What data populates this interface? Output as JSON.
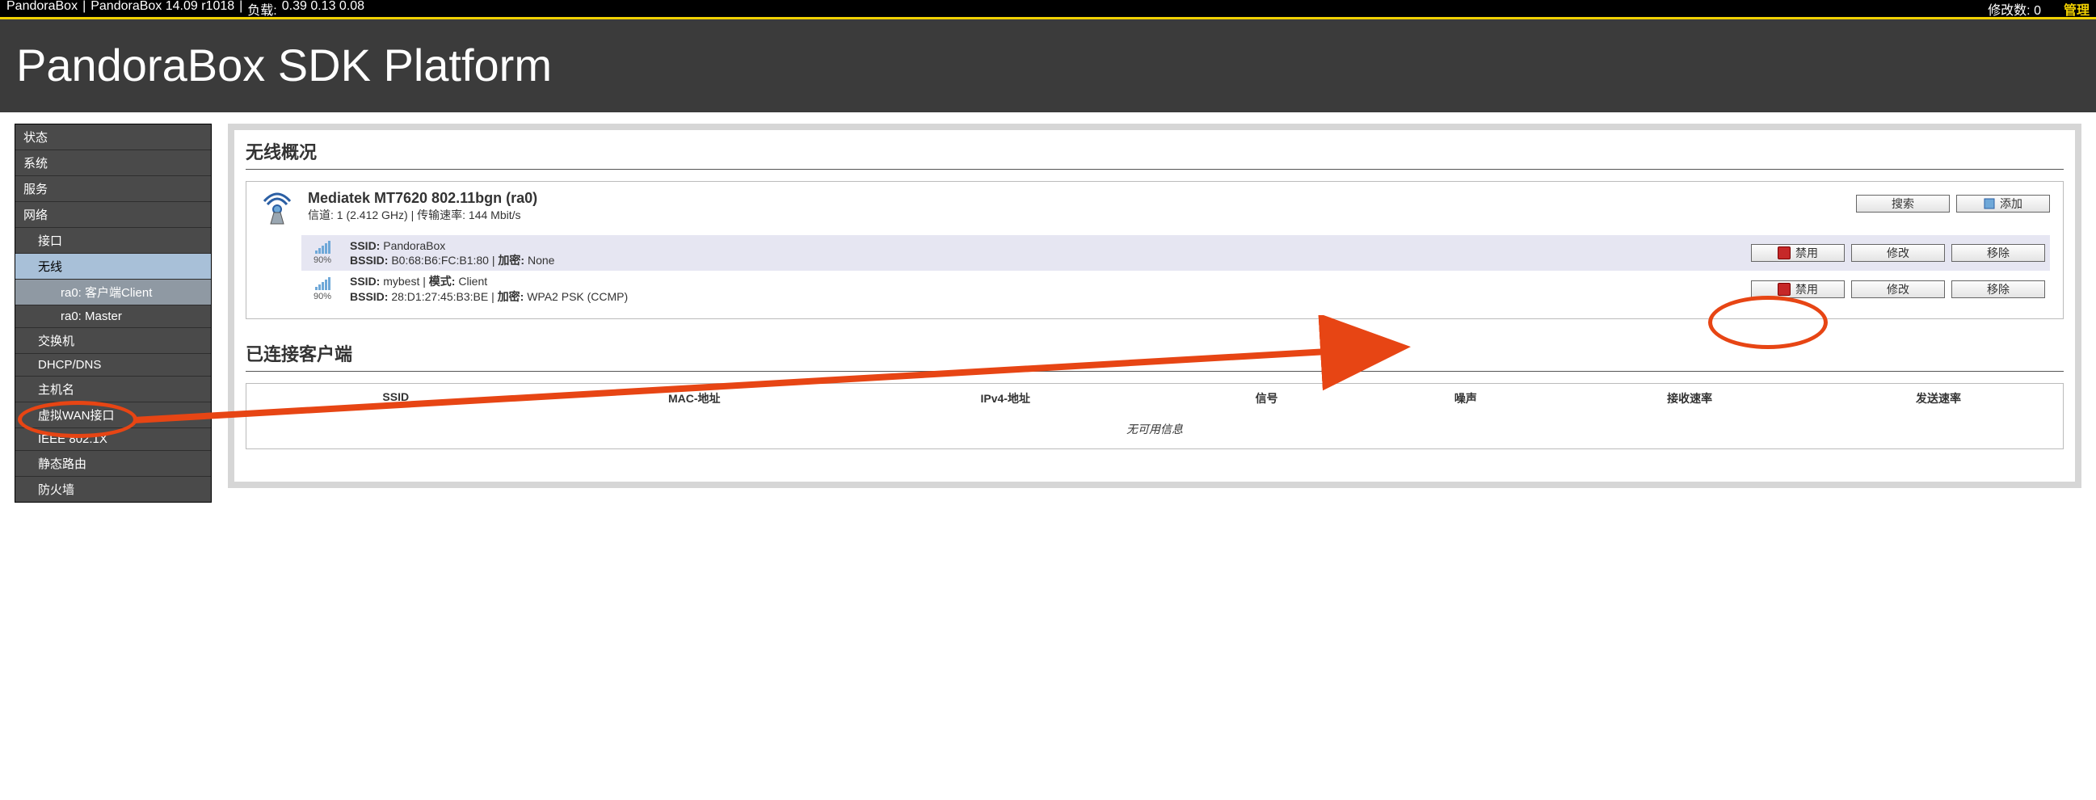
{
  "topbar": {
    "product": "PandoraBox",
    "version": "PandoraBox 14.09 r1018",
    "load_label": "负载:",
    "load_values": "0.39 0.13 0.08",
    "changes_label": "修改数:",
    "changes_count": "0",
    "admin_label": "管理"
  },
  "banner": {
    "title": "PandoraBox SDK Platform"
  },
  "sidebar": {
    "items": [
      {
        "label": "状态",
        "level": 0
      },
      {
        "label": "系统",
        "level": 0
      },
      {
        "label": "服务",
        "level": 0
      },
      {
        "label": "网络",
        "level": 0
      },
      {
        "label": "接口",
        "level": 1
      },
      {
        "label": "无线",
        "level": 1,
        "active": true
      },
      {
        "label": "ra0: 客户端Client",
        "level": 2,
        "hl": true
      },
      {
        "label": "ra0: Master",
        "level": 2
      },
      {
        "label": "交换机",
        "level": 1
      },
      {
        "label": "DHCP/DNS",
        "level": 1
      },
      {
        "label": "主机名",
        "level": 1
      },
      {
        "label": "虚拟WAN接口",
        "level": 1
      },
      {
        "label": "IEEE 802.1X",
        "level": 1
      },
      {
        "label": "静态路由",
        "level": 1
      },
      {
        "label": "防火墙",
        "level": 1
      }
    ]
  },
  "overview": {
    "title": "无线概况",
    "device": {
      "name": "Mediatek MT7620 802.11bgn (ra0)",
      "channel_label": "信道:",
      "channel": "1 (2.412 GHz)",
      "rate_label": "传输速率:",
      "rate": "144 Mbit/s"
    },
    "actions": {
      "search": "搜索",
      "add": "添加"
    },
    "networks": [
      {
        "signal_pct": "90%",
        "ssid_label": "SSID:",
        "ssid": "PandoraBox",
        "bssid_label": "BSSID:",
        "bssid": "B0:68:B6:FC:B1:80",
        "enc_label": "加密:",
        "enc": "None"
      },
      {
        "signal_pct": "90%",
        "ssid_label": "SSID:",
        "ssid": "mybest",
        "mode_label": "模式:",
        "mode": "Client",
        "bssid_label": "BSSID:",
        "bssid": "28:D1:27:45:B3:BE",
        "enc_label": "加密:",
        "enc": "WPA2 PSK (CCMP)"
      }
    ],
    "row_actions": {
      "disable": "禁用",
      "edit": "修改",
      "remove": "移除"
    }
  },
  "clients": {
    "title": "已连接客户端",
    "headers": [
      "SSID",
      "MAC-地址",
      "IPv4-地址",
      "信号",
      "噪声",
      "接收速率",
      "发送速率"
    ],
    "empty": "无可用信息"
  }
}
